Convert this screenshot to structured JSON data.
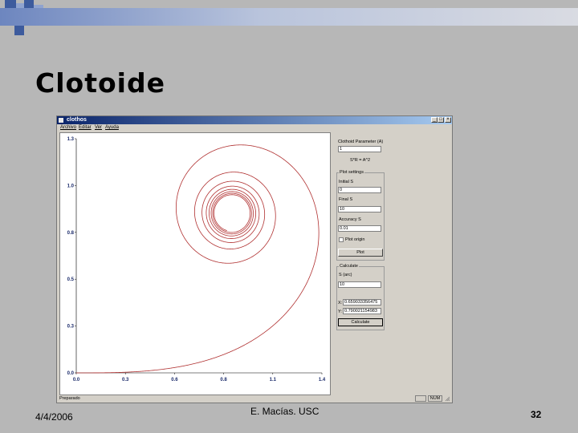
{
  "slide": {
    "title": "Clotoide",
    "date": "4/4/2006",
    "author": "E. Macías. USC",
    "page": "32"
  },
  "window": {
    "title": "clothos",
    "menu": [
      "Archivo",
      "Editar",
      "Ver",
      "Ayuda"
    ],
    "status_text": "Preparado",
    "status_num": "NUM"
  },
  "panel": {
    "param_label": "Clothoid Parameter (A)",
    "param_value": "1",
    "formula": "S*R = A^2",
    "plot_group": "Plot settings",
    "initial_label": "Initial S",
    "initial_value": "0",
    "final_label": "Final S",
    "final_value": "10",
    "accuracy_label": "Accuracy S",
    "accuracy_value": "0.01",
    "plot_origin_label": "Plot origin",
    "plot_button": "Plot",
    "calc_group": "Calculate",
    "s_label": "S (arc)",
    "s_value": "10",
    "x_label": "X:",
    "x_value": "0.659033356475",
    "y_label": "Y:",
    "y_value": "0.790021154983",
    "calc_button": "Calculate"
  },
  "chart_data": {
    "type": "line",
    "title": "",
    "xlabel": "",
    "ylabel": "",
    "xlim": [
      0,
      1.4
    ],
    "ylim": [
      0,
      1.3
    ],
    "x_ticks": [
      "0.0",
      "0.3",
      "0.6",
      "0.8",
      "1.1",
      "1.4"
    ],
    "y_ticks": [
      "0.0",
      "0.3",
      "0.5",
      "0.8",
      "1.0",
      "1.3"
    ],
    "grid": false,
    "line_color": "#b03030",
    "curve": "clothoid",
    "clothoid_parameter": 1,
    "s_range": [
      0,
      10
    ]
  }
}
